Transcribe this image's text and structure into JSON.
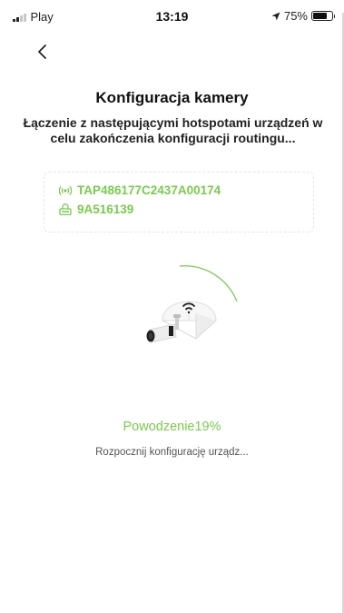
{
  "status_bar": {
    "carrier": "Play",
    "time": "13:19",
    "battery_percent_label": "75%",
    "battery_level": 0.75
  },
  "header": {
    "back_icon": "chevron-left-icon"
  },
  "main": {
    "title": "Konfiguracja kamery",
    "subtitle": "Łączenie z następującymi hotspotami urządzeń w celu zakończenia konfiguracji routingu...",
    "hotspot": {
      "ssid": "TAP486177C2437A00174",
      "ssid_icon": "wifi-signal-icon",
      "password": "9A516139",
      "password_icon": "wifi-lock-icon"
    },
    "progress": {
      "label": "Powodzenie19%",
      "value_percent": 19,
      "step_text": "Rozpocznij konfigurację urządz..."
    }
  },
  "colors": {
    "accent": "#77cc4a",
    "text": "#1a1a1a",
    "secondary_text": "#555555",
    "box_border": "#e5e5e5"
  }
}
